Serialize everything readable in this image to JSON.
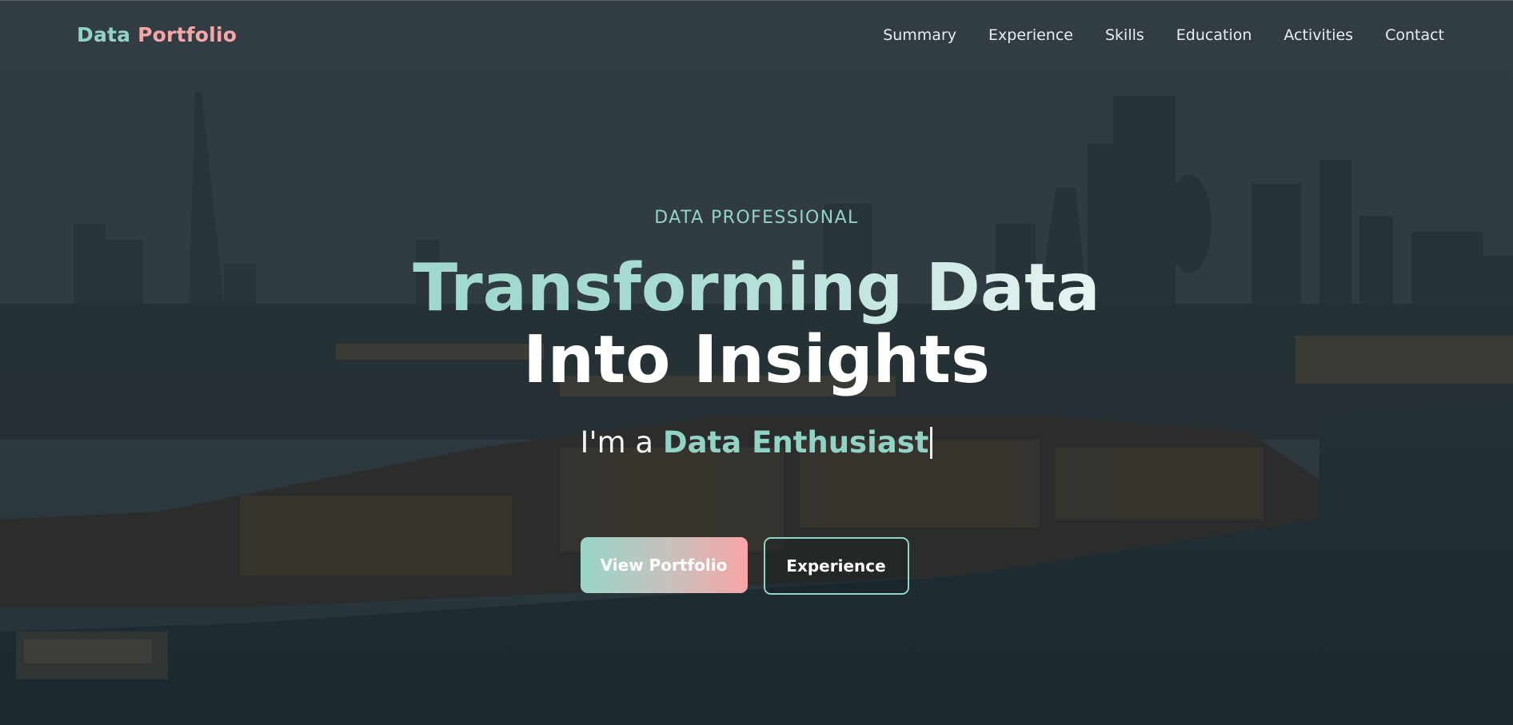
{
  "brand": {
    "part1": "Data",
    "part2": "Portfolio"
  },
  "nav": {
    "items": [
      {
        "label": "Summary"
      },
      {
        "label": "Experience"
      },
      {
        "label": "Skills"
      },
      {
        "label": "Education"
      },
      {
        "label": "Activities"
      },
      {
        "label": "Contact"
      }
    ]
  },
  "hero": {
    "eyebrow": "DATA PROFESSIONAL",
    "headline_line1": "Transforming Data",
    "headline_line2": "Into Insights",
    "tagline_prefix": "I'm a ",
    "tagline_role": "Data Enthusiast",
    "primary_button": "View Portfolio",
    "secondary_button": "Experience"
  },
  "colors": {
    "accent_teal": "#93d3c6",
    "accent_pink": "#f6a6a8",
    "overlay": "#2b3a40"
  }
}
